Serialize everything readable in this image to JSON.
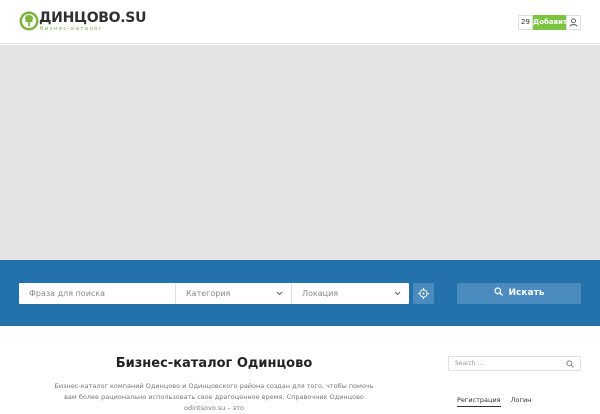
{
  "header": {
    "logo_text": "ДИНЦОВО.SU",
    "logo_tagline": "бизнес-каталог",
    "counter": "29",
    "add_label": "Добавить",
    "user_icon": "user-icon"
  },
  "search": {
    "phrase_placeholder": "Фраза для поиска",
    "category_label": "Категория",
    "location_label": "Локация",
    "geo_icon": "crosshair-icon",
    "button_label": "Искать"
  },
  "main": {
    "title": "Бизнес-каталог Одинцово",
    "intro": "Бизнес-каталог компаний Одинцово и Одинцовского района создан для того, чтобы помочь вам более рационально использовать свое драгоценное время. Справочник Одинцово odintsovo.su – это"
  },
  "sidebar": {
    "search_placeholder": "Search ...",
    "tabs": [
      "Регистрация",
      "Логин"
    ]
  },
  "colors": {
    "brand_green": "#7cc33f",
    "band_blue": "#2472ac",
    "button_blue": "#4a8cc0"
  }
}
